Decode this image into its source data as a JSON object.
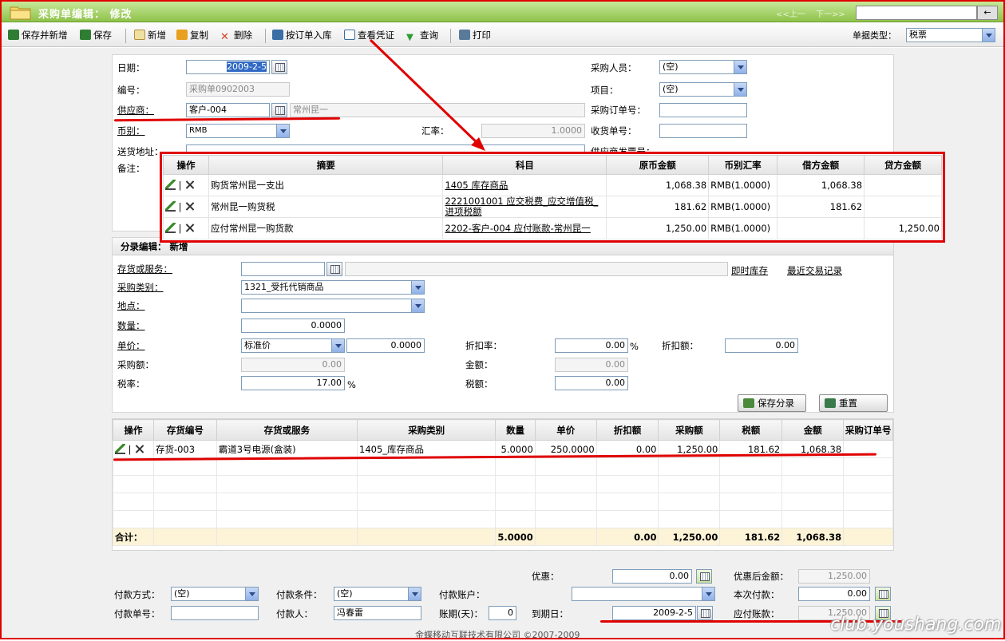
{
  "window": {
    "title": "采购单编辑： 修改",
    "prev": "<<上一",
    "next": "下一>>",
    "top_btn": "←"
  },
  "toolbar": {
    "items": [
      {
        "label": "保存并新增",
        "color": "#2e7d32"
      },
      {
        "label": "保存",
        "color": "#2e7d32"
      },
      {
        "label": "新增",
        "color": "#f0c040"
      },
      {
        "label": "复制",
        "color": "#e8a020"
      },
      {
        "label": "删除",
        "color": "#d04020"
      },
      {
        "label": "按订单入库",
        "color": "#3a6ea5"
      },
      {
        "label": "查看凭证",
        "color": "#3a6ea5"
      },
      {
        "label": "查询",
        "color": "#2e9d32"
      },
      {
        "label": "打印",
        "color": "#5a7a9a"
      }
    ],
    "doctype_label": "单据类型：",
    "doctype_value": "税票"
  },
  "form": {
    "date_label": "日期：",
    "date_value": "2009-2-5",
    "number_label": "编号：",
    "number_value": "采购单0902003",
    "supplier_label": "供应商：",
    "supplier_code": "客户-004",
    "supplier_name": "常州昆一",
    "currency_label": "币别：",
    "currency_value": "RMB",
    "rate_label": "汇率：",
    "rate_value": "1.0000",
    "address_label": "送货地址：",
    "remark_label": "备注：",
    "buyer_label": "采购人员：",
    "buyer_value": "(空)",
    "project_label": "项目：",
    "project_value": "(空)",
    "order_no_label": "采购订单号：",
    "receipt_no_label": "收货单号：",
    "supplier_invoice_label": "供应商发票号："
  },
  "voucher": {
    "headers": [
      "操作",
      "摘要",
      "科目",
      "原币金额",
      "币别汇率",
      "借方金额",
      "贷方金额"
    ],
    "rows": [
      {
        "summary": "购货常州昆一支出",
        "account": "1405 库存商品",
        "amount": "1,068.38",
        "currency": "RMB(1.0000)",
        "debit": "1,068.38",
        "credit": ""
      },
      {
        "summary": "常州昆一购货税",
        "account": "2221001001 应交税费_应交增值税_进项税额",
        "amount": "181.62",
        "currency": "RMB(1.0000)",
        "debit": "181.62",
        "credit": ""
      },
      {
        "summary": "应付常州昆一购货款",
        "account": "2202-客户-004 应付账款-常州昆一",
        "amount": "1,250.00",
        "currency": "RMB(1.0000)",
        "debit": "",
        "credit": "1,250.00"
      }
    ]
  },
  "entry": {
    "title": "分录编辑： 新增",
    "item_label": "存货或服务：",
    "stock_link": "即时库存",
    "recent_link": "最近交易记录",
    "category_label": "采购类别：",
    "category_value": "1321_受托代销商品",
    "location_label": "地点：",
    "qty_label": "数量：",
    "qty_value": "0.0000",
    "price_label": "单价：",
    "price_type": "标准价",
    "price_value": "0.0000",
    "discount_rate_label": "折扣率：",
    "discount_rate_value": "0.00",
    "pct": "%",
    "discount_amount_label": "折扣额：",
    "discount_amount_value": "0.00",
    "purchase_amount_label": "采购额：",
    "purchase_amount_value": "0.00",
    "amount_label": "金额：",
    "amount_value": "0.00",
    "tax_rate_label": "税率：",
    "tax_rate_value": "17.00",
    "tax_label": "税额：",
    "tax_value": "0.00",
    "save_btn": "保存分录",
    "reset_btn": "重置"
  },
  "grid": {
    "headers": [
      "操作",
      "存货编号",
      "存货或服务",
      "采购类别",
      "数量",
      "单价",
      "折扣额",
      "采购额",
      "税额",
      "金额",
      "采购订单号"
    ],
    "rows": [
      {
        "code": "存货-003",
        "name": "霸道3号电源(盒装)",
        "category": "1405_库存商品",
        "qty": "5.0000",
        "price": "250.0000",
        "discount": "0.00",
        "purchase": "1,250.00",
        "tax": "181.62",
        "amount": "1,068.38",
        "order": ""
      }
    ],
    "total_label": "合计：",
    "total": {
      "qty": "5.0000",
      "discount": "0.00",
      "purchase": "1,250.00",
      "tax": "181.62",
      "amount": "1,068.38"
    }
  },
  "footer": {
    "discount_label": "优惠：",
    "discount_value": "0.00",
    "after_discount_label": "优惠后金额：",
    "after_discount_value": "1,250.00",
    "pay_method_label": "付款方式：",
    "pay_method_value": "(空)",
    "pay_terms_label": "付款条件：",
    "pay_terms_value": "(空)",
    "pay_account_label": "付款账户：",
    "this_pay_label": "本次付款：",
    "this_pay_value": "0.00",
    "pay_no_label": "付款单号：",
    "payer_label": "付款人：",
    "payer_value": "冯春雷",
    "term_days_label": "账期(天)：",
    "term_days_value": "0",
    "due_label": "到期日：",
    "due_value": "2009-2-5",
    "payable_label": "应付账款：",
    "payable_value": "1,250.00"
  },
  "copyright": "金蝶移动互联技术有限公司 ©2007-2009",
  "watermark": "club.youshang.com"
}
